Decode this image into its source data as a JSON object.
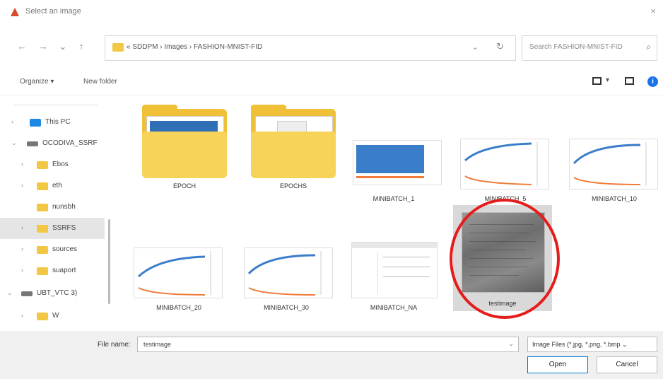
{
  "window": {
    "title": "Select an image",
    "icon": "app-icon",
    "close_icon": "×"
  },
  "nav": {
    "back_glyph": "←",
    "forward_glyph": "→",
    "recent_glyph": "⌄",
    "up_glyph": "↑",
    "address": "« SDDPM › Images › FASHION-MNIST-FID",
    "address_dropdown": "⌄",
    "refresh_glyph": "↻",
    "search_placeholder": "Search FASHION-MNIST-FID",
    "search_glyph": "⌕"
  },
  "toolbar": {
    "organize": "Organize ▾",
    "new_folder": "New folder",
    "view_dropdown": "▾",
    "help": "i"
  },
  "sidebar": {
    "items": [
      {
        "label": "This PC",
        "icon": "pc-icon",
        "chevron": "›"
      },
      {
        "label": "OCODIVA_SSRF",
        "icon": "drive-icon",
        "chevron": "⌄"
      },
      {
        "label": "Ebos",
        "icon": "folder-icon",
        "chevron": "›"
      },
      {
        "label": "eth",
        "icon": "folder-icon",
        "chevron": "›"
      },
      {
        "label": "nunsbh",
        "icon": "folder-icon",
        "chevron": ""
      },
      {
        "label": "SSRFS",
        "icon": "folder-icon",
        "chevron": "›"
      },
      {
        "label": "sources",
        "icon": "folder-icon",
        "chevron": "›"
      },
      {
        "label": "suaport",
        "icon": "folder-icon",
        "chevron": "›"
      },
      {
        "label": "UBT_VTC 3)",
        "icon": "drive-icon",
        "chevron": "⌄"
      },
      {
        "label": "W",
        "icon": "folder-icon",
        "chevron": "›"
      }
    ]
  },
  "files": [
    {
      "name": "EPOCH",
      "kind": "folder"
    },
    {
      "name": "EPOCHS",
      "kind": "folder"
    },
    {
      "name": "MINIBATCH_1",
      "kind": "chart"
    },
    {
      "name": "MINIBATCH_5",
      "kind": "chart"
    },
    {
      "name": "MINIBATCH_10",
      "kind": "chart"
    },
    {
      "name": "MINIBATCH_20",
      "kind": "chart"
    },
    {
      "name": "MINIBATCH_30",
      "kind": "chart"
    },
    {
      "name": "MINIBATCH_NA",
      "kind": "table"
    },
    {
      "name": "testimage",
      "kind": "photo",
      "selected": true
    }
  ],
  "footer": {
    "filename_label": "File name:",
    "filename_value": "testimage",
    "filename_dropdown": "⌄",
    "filetype": "Image Files (*.jpg, *.png, *.bmp ⌄",
    "open_label": "Open",
    "cancel_label": "Cancel"
  },
  "colors": {
    "accent": "#0078d4",
    "highlight": "#e51c1c",
    "folder": "#f0c036",
    "selection": "#d9d9d9"
  }
}
